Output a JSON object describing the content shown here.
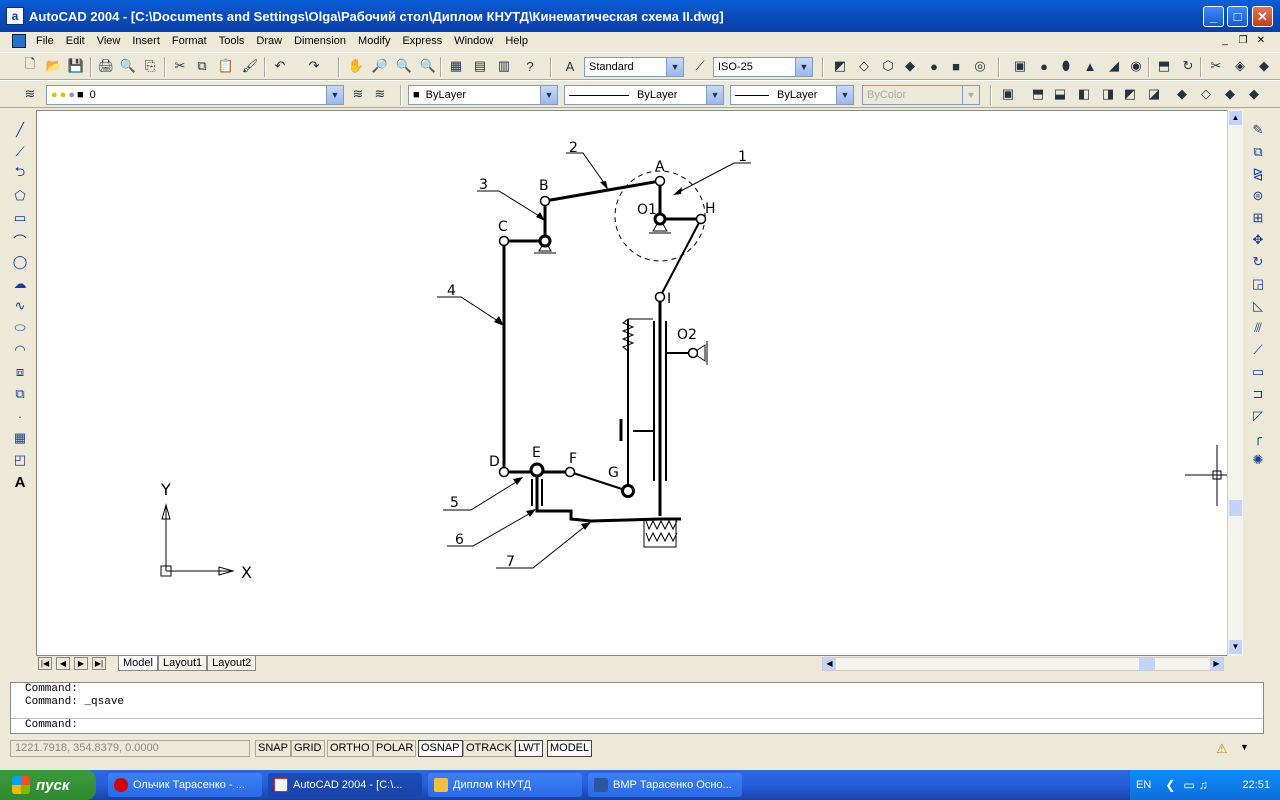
{
  "window": {
    "title": "AutoCAD 2004 - [C:\\Documents and Settings\\Olga\\Рабочий стол\\Диплом КНУТД\\Кинематическая схема II.dwg]",
    "app_icon_letter": "a",
    "buttons": {
      "minimize": "_",
      "maximize": "□",
      "close": "✕"
    }
  },
  "menu": {
    "items": [
      "File",
      "Edit",
      "View",
      "Insert",
      "Format",
      "Tools",
      "Draw",
      "Dimension",
      "Modify",
      "Express",
      "Window",
      "Help"
    ],
    "mdi": {
      "minimize": "_",
      "restore": "❐",
      "close": "✕"
    }
  },
  "toolbar_standard": {
    "text_style": "Standard",
    "dim_style": "ISO-25"
  },
  "toolbar_layers": {
    "layer": "0",
    "color": "ByLayer",
    "linetype": "ByLayer",
    "lineweight": "ByLayer",
    "plot_style": "ByColor"
  },
  "drawing": {
    "points": [
      "A",
      "B",
      "C",
      "D",
      "E",
      "F",
      "G",
      "H",
      "I",
      "O1",
      "O2"
    ],
    "callouts": [
      "1",
      "2",
      "3",
      "4",
      "5",
      "6",
      "7"
    ],
    "ucs": {
      "x": "X",
      "y": "Y"
    }
  },
  "layout_tabs": [
    "Model",
    "Layout1",
    "Layout2"
  ],
  "active_tab": "Model",
  "command_lines": [
    "Command:",
    "Command: _qsave",
    "Command:"
  ],
  "status": {
    "coords": "1221.7918, 354.8379, 0.0000",
    "toggles": [
      {
        "label": "SNAP",
        "on": false
      },
      {
        "label": "GRID",
        "on": false
      },
      {
        "label": "ORTHO",
        "on": false
      },
      {
        "label": "POLAR",
        "on": false
      },
      {
        "label": "OSNAP",
        "on": true
      },
      {
        "label": "OTRACK",
        "on": false
      },
      {
        "label": "LWT",
        "on": true
      },
      {
        "label": "MODEL",
        "on": true
      }
    ]
  },
  "taskbar": {
    "start_label": "пуск",
    "tasks": [
      {
        "label": "Ольчик Тарасенко - ...",
        "icon_color": "#d40000"
      },
      {
        "label": "AutoCAD 2004 - [C:\\...",
        "icon_color": "#c33"
      },
      {
        "label": "Диплом КНУТД",
        "icon_color": "#f0c040"
      },
      {
        "label": "ВМР Тарасенко Осно...",
        "icon_color": "#2b579a"
      }
    ],
    "lang": "EN",
    "time": "22:51"
  },
  "colors": {
    "titlebar": "#0b4fbf",
    "taskbar": "#245edc",
    "start": "#2f8a2f"
  }
}
